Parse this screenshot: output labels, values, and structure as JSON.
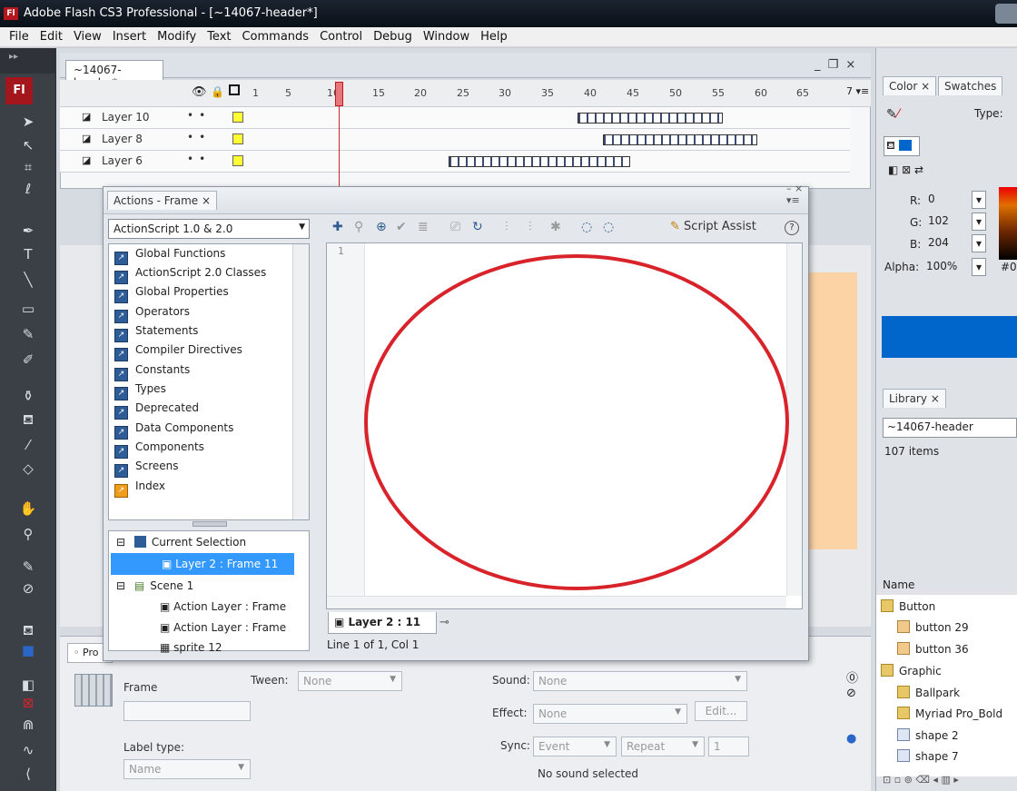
{
  "window": {
    "title": "Adobe Flash CS3 Professional - [~14067-header*]",
    "app_badge": "Fl"
  },
  "menu": [
    "File",
    "Edit",
    "View",
    "Insert",
    "Modify",
    "Text",
    "Commands",
    "Control",
    "Debug",
    "Window",
    "Help"
  ],
  "document": {
    "tab": "~14067-header*",
    "window_controls": "_ ❐ ×"
  },
  "timeline": {
    "frame_numbers": [
      "1",
      "5",
      "10",
      "15",
      "20",
      "25",
      "30",
      "35",
      "40",
      "45",
      "50",
      "55",
      "60",
      "65"
    ],
    "layers": [
      "Layer 10",
      "Layer 8",
      "Layer 6"
    ],
    "current_frame": 11
  },
  "actions_panel": {
    "tab": "Actions - Frame ×",
    "version_select": "ActionScript 1.0 & 2.0",
    "toolbox": [
      "Global Functions",
      "ActionScript 2.0 Classes",
      "Global Properties",
      "Operators",
      "Statements",
      "Compiler Directives",
      "Constants",
      "Types",
      "Deprecated",
      "Data Components",
      "Components",
      "Screens",
      "Index"
    ],
    "script_assist": "Script Assist",
    "line_number": "1",
    "navigator": {
      "current_selection": "Current Selection",
      "selected_item": "Layer 2 : Frame 11",
      "scene": "Scene 1",
      "items": [
        "Action Layer : Frame",
        "Action Layer : Frame",
        "sprite 12"
      ]
    },
    "script_tab": "Layer 2 : 11",
    "status": "Line 1 of 1, Col 1"
  },
  "properties": {
    "tab": "Pro",
    "frame_label": "Frame",
    "tween_label": "Tween:",
    "tween_value": "None",
    "label_type_label": "Label type:",
    "label_type_value": "Name",
    "sound_label": "Sound:",
    "sound_value": "None",
    "effect_label": "Effect:",
    "effect_value": "None",
    "edit_button": "Edit...",
    "sync_label": "Sync:",
    "sync_value": "Event",
    "repeat_value": "Repeat",
    "repeat_count": "1",
    "sound_status": "No sound selected"
  },
  "color_panel": {
    "tabs": [
      "Color ×",
      "Swatches"
    ],
    "type_label": "Type:",
    "r_label": "R:",
    "r_value": "0",
    "g_label": "G:",
    "g_value": "102",
    "b_label": "B:",
    "b_value": "204",
    "alpha_label": "Alpha:",
    "alpha_value": "100%",
    "hex_value": "#0",
    "fill_color": "#0066cc"
  },
  "library_panel": {
    "tab": "Library ×",
    "document": "~14067-header",
    "count": "107 items",
    "column_header": "Name",
    "items": [
      {
        "name": "Button",
        "kind": "folder"
      },
      {
        "name": "button 29",
        "kind": "button"
      },
      {
        "name": "button 36",
        "kind": "button"
      },
      {
        "name": "Graphic",
        "kind": "folder"
      },
      {
        "name": "Ballpark",
        "kind": "folder"
      },
      {
        "name": "Myriad Pro_Bold",
        "kind": "folder"
      },
      {
        "name": "shape 2",
        "kind": "graphic"
      },
      {
        "name": "shape 7",
        "kind": "graphic"
      }
    ]
  },
  "annotation": {
    "shape": "ellipse",
    "color": "#d9232a"
  }
}
